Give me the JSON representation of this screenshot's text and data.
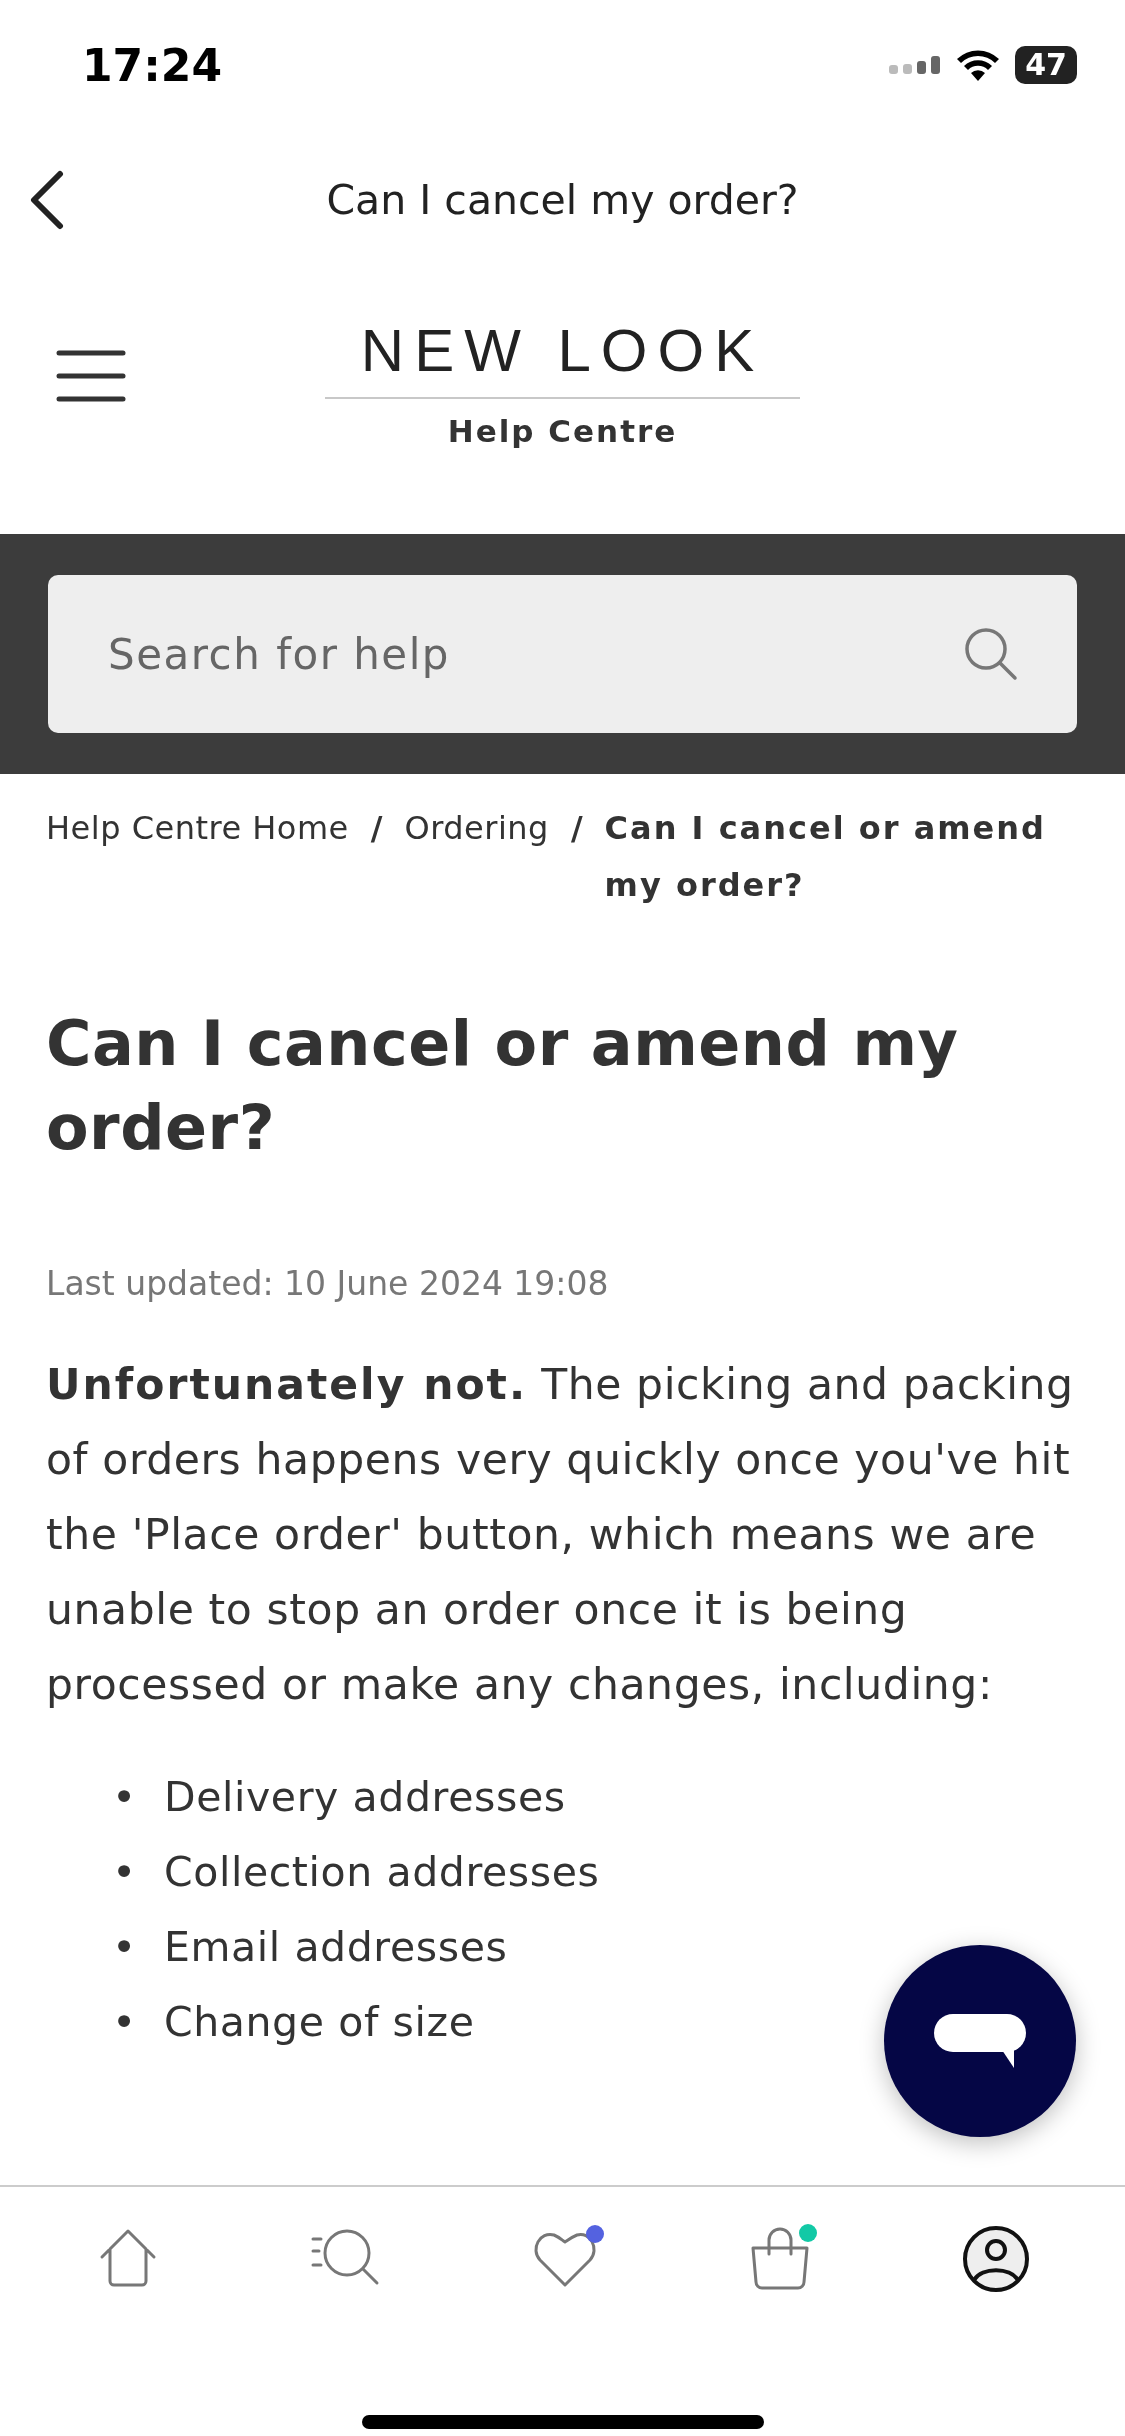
{
  "status_bar": {
    "time": "17:24",
    "battery": "47"
  },
  "nav": {
    "title": "Can I cancel my order?"
  },
  "brand": {
    "logo": "NEW LOOK",
    "subtitle": "Help Centre"
  },
  "search": {
    "placeholder": "Search for help"
  },
  "breadcrumb": [
    {
      "label": "Help Centre Home",
      "current": false
    },
    {
      "separator": "/",
      "label": "Ordering",
      "current": false
    },
    {
      "separator": "/",
      "label": "Can I cancel or amend my order?",
      "current": true
    }
  ],
  "article": {
    "title": "Can I cancel or amend my order?",
    "updated": "Last updated: 10 June 2024 19:08",
    "body": "**Unfortunately not.** The picking and packing of orders happens very quickly once you've hit the 'Place order' button, which means we are unable to stop an order once it is being processed or make any changes, including:",
    "bullets": [
      {
        "marker": "•",
        "text": "Delivery addresses"
      },
      {
        "marker": "•",
        "text": "Collection addresses"
      },
      {
        "marker": "•",
        "text": "Email addresses"
      },
      {
        "marker": "•",
        "text": "Change of size"
      }
    ]
  },
  "tab_bar": [
    {
      "kind": "home",
      "selected": false
    },
    {
      "kind": "search",
      "selected": false
    },
    {
      "kind": "wishlist",
      "selected": false,
      "color": "#5462e0"
    },
    {
      "kind": "bag",
      "selected": false,
      "color": "#12c9a6"
    },
    {
      "kind": "account",
      "selected": true
    }
  ]
}
